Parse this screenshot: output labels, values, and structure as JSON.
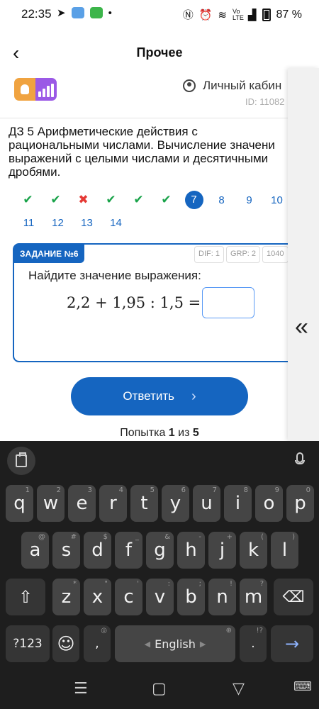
{
  "status_bar": {
    "time": "22:35",
    "battery": "87 %",
    "network_label": "Vo LTE"
  },
  "app_bar": {
    "title": "Прочее"
  },
  "site_header": {
    "account_label": "Личный кабин",
    "user_id": "ID: 11082"
  },
  "task_title": {
    "line1": "ДЗ 5 Арифметические действия с",
    "line2": "рациональными числами. Вычисление значени",
    "line3": "выражений с целыми числами и десятичными",
    "line4": "дробями."
  },
  "task_nav": {
    "row1": [
      {
        "label": "✔",
        "state": "correct"
      },
      {
        "label": "✔",
        "state": "correct"
      },
      {
        "label": "✖",
        "state": "wrong"
      },
      {
        "label": "✔",
        "state": "correct"
      },
      {
        "label": "✔",
        "state": "correct"
      },
      {
        "label": "✔",
        "state": "correct"
      },
      {
        "label": "7",
        "state": "current"
      },
      {
        "label": "8",
        "state": "pending"
      },
      {
        "label": "9",
        "state": "pending"
      },
      {
        "label": "10",
        "state": "pending"
      }
    ],
    "row2": [
      {
        "label": "11",
        "state": "pending"
      },
      {
        "label": "12",
        "state": "pending"
      },
      {
        "label": "13",
        "state": "pending"
      },
      {
        "label": "14",
        "state": "pending"
      }
    ]
  },
  "task_card": {
    "tag": "ЗАДАНИЕ №6",
    "chips": [
      "DIF: 1",
      "GRP: 2",
      "1040"
    ],
    "question": "Найдите значение выражения:",
    "expression": "2,2 + 1,95 : 1,5 =",
    "answer_value": ""
  },
  "side_panel": {
    "collapse_glyph": "«"
  },
  "submit": {
    "label": "Ответить",
    "arrow": "›"
  },
  "attempts": {
    "prefix": "Попытка ",
    "current": "1",
    "middle": " из ",
    "total": "5"
  },
  "keyboard": {
    "row1": [
      {
        "k": "q",
        "h": "1"
      },
      {
        "k": "w",
        "h": "2"
      },
      {
        "k": "e",
        "h": "3"
      },
      {
        "k": "r",
        "h": "4"
      },
      {
        "k": "t",
        "h": "5"
      },
      {
        "k": "y",
        "h": "6"
      },
      {
        "k": "u",
        "h": "7"
      },
      {
        "k": "i",
        "h": "8"
      },
      {
        "k": "o",
        "h": "9"
      },
      {
        "k": "p",
        "h": "0"
      }
    ],
    "row2": [
      {
        "k": "a",
        "h": "@"
      },
      {
        "k": "s",
        "h": "#"
      },
      {
        "k": "d",
        "h": "$"
      },
      {
        "k": "f",
        "h": "_"
      },
      {
        "k": "g",
        "h": "&"
      },
      {
        "k": "h",
        "h": "-"
      },
      {
        "k": "j",
        "h": "+"
      },
      {
        "k": "k",
        "h": "("
      },
      {
        "k": "l",
        "h": ")"
      }
    ],
    "row3": [
      {
        "k": "z",
        "h": "*"
      },
      {
        "k": "x",
        "h": "\""
      },
      {
        "k": "c",
        "h": "'"
      },
      {
        "k": "v",
        "h": ":"
      },
      {
        "k": "b",
        "h": ";"
      },
      {
        "k": "n",
        "h": "!"
      },
      {
        "k": "m",
        "h": "?"
      }
    ],
    "shift": "⇧",
    "backspace": "⌫",
    "symbols": "?123",
    "emoji": "☺",
    "comma": ",",
    "space_label": "English",
    "period": ".",
    "period_hint": "!?",
    "enter": "→"
  },
  "nav_bar": {
    "recents": "☰",
    "home": "▢",
    "back": "▽",
    "keyboard_switch": "⌨"
  }
}
